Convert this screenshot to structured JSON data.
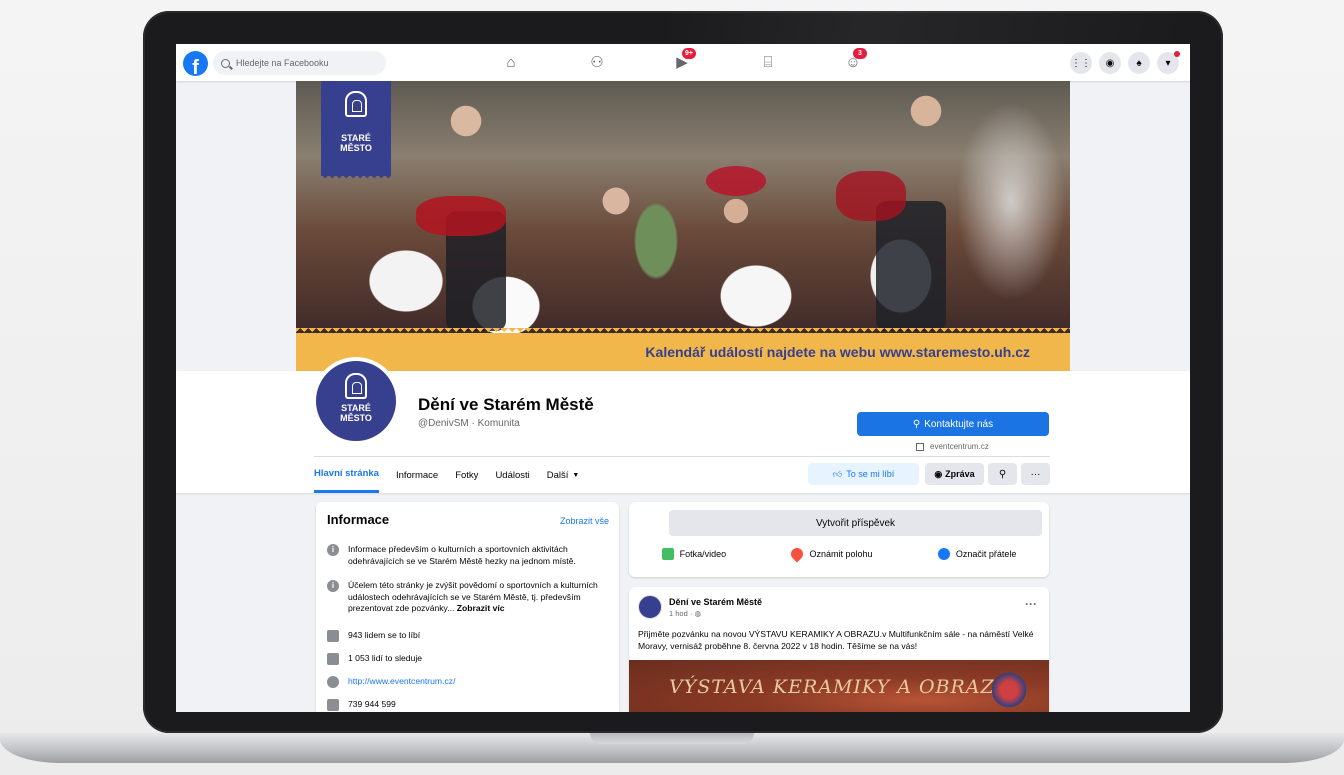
{
  "topbar": {
    "logo": "f",
    "search_placeholder": "Hledejte na Facebooku",
    "nav_icons": [
      "home-icon",
      "friends-icon",
      "watch-icon",
      "marketplace-icon",
      "groups-icon"
    ],
    "watch_badge": "9+",
    "groups_badge": "3",
    "right_icons": [
      "menu-grid-icon",
      "messenger-icon",
      "notifications-icon",
      "account-chevron-icon"
    ]
  },
  "cover": {
    "logo_line1": "STARÉ",
    "logo_line2": "MĚSTO",
    "banner_text": "Kalendář událostí najdete na webu www.staremesto.uh.cz"
  },
  "profile": {
    "avatar_line1": "STARÉ",
    "avatar_line2": "MĚSTO",
    "name": "Dění ve Starém Městě",
    "handle": "@DenivSM · Komunita",
    "contact_button": "Kontaktujte nás",
    "external_link": "eventcentrum.cz",
    "tabs": [
      "Hlavní stránka",
      "Informace",
      "Fotky",
      "Události",
      "Další"
    ],
    "like_button": "To se mi líbí",
    "message_button": "Zpráva"
  },
  "info": {
    "title": "Informace",
    "show_all": "Zobrazit vše",
    "description1": "Informace především o kulturních a sportovních aktivitách odehrávajících se ve Starém Městě hezky na jednom místě.",
    "description2": "Účelem této stránky je zvýšit povědomí o sportovních a kulturních událostech odehrávajících se ve Starém Městě, tj. především prezentovat zde pozvánky...",
    "show_more": "Zobrazit víc",
    "likes": "943 lidem se to líbí",
    "followers": "1 053 lidí to sleduje",
    "website": "http://www.eventcentrum.cz/",
    "phone": "739 944 599"
  },
  "composer": {
    "create_post": "Vytvořit příspěvek",
    "photo_video": "Fotka/video",
    "check_in": "Oznámit polohu",
    "tag_friends": "Označit přátele"
  },
  "post": {
    "author": "Dění ve Starém Městě",
    "time": "1 hod · ",
    "text": "Přijměte pozvánku na novou VÝSTAVU KERAMIKY A OBRAZU.v Multifunkčním sále - na náměstí Velké Moravy, vernisáž proběhne 8. června 2022 v 18 hodin. Těšíme se na vás!",
    "image_text": "VÝSTAVA KERAMIKY A OBRAZŮ"
  },
  "colors": {
    "facebook_blue": "#1877f2",
    "brand_blue": "#36408f",
    "banner_yellow": "#f2b74a"
  }
}
